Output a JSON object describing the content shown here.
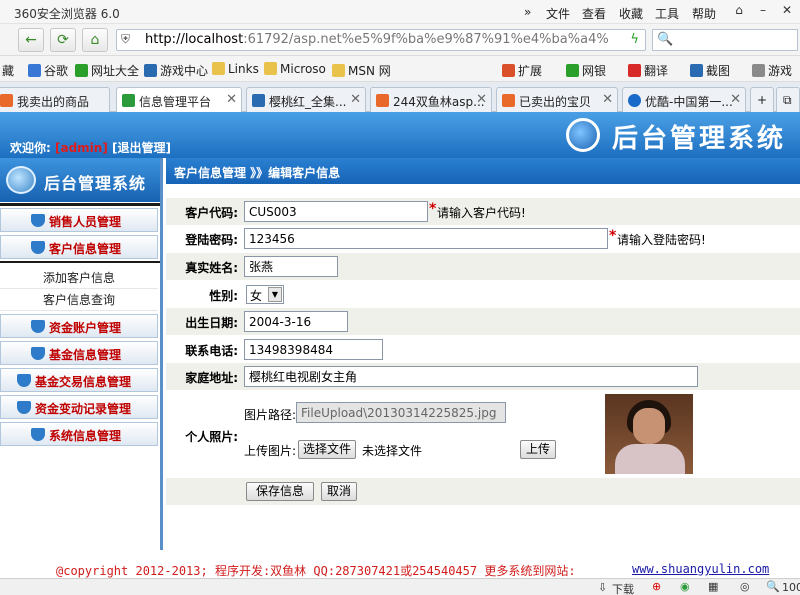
{
  "browser": {
    "title": "360安全浏览器 6.0",
    "menu": [
      "文件",
      "查看",
      "收藏",
      "工具",
      "帮助"
    ],
    "url_host": "http://localhost",
    "url_rest": ":61792/asp.net%e5%9f%ba%e9%87%91%e4%ba%a4%",
    "bookmarks": [
      "藏",
      "谷歌",
      "网址大全",
      "游戏中心",
      "Links",
      "Microso",
      "MSN 网"
    ],
    "toolbar_right": [
      "扩展",
      "网银",
      "翻译",
      "截图",
      "游戏"
    ],
    "tabs": [
      {
        "label": "我卖出的商品",
        "color": "#e8692a"
      },
      {
        "label": "信息管理平台",
        "color": "#2a9a3a"
      },
      {
        "label": "樱桃红_全集...",
        "color": "#2a6ab0"
      },
      {
        "label": "244双鱼林asp...",
        "color": "#e8692a"
      },
      {
        "label": "已卖出的宝贝",
        "color": "#e8692a"
      },
      {
        "label": "优酷-中国第一...",
        "color": "#1a6ac9"
      }
    ],
    "status": {
      "download": "下载",
      "zoom": "100"
    }
  },
  "header": {
    "welcome": "欢迎你:",
    "user": "[admin]",
    "logout": "[退出管理]",
    "system_title": "后台管理系统"
  },
  "sidebar": {
    "title": "后台管理系统",
    "items": [
      {
        "label": "销售人员管理"
      },
      {
        "label": "客户信息管理"
      },
      {
        "label": "资金账户管理"
      },
      {
        "label": "基金信息管理"
      },
      {
        "label": "基金交易信息管理"
      },
      {
        "label": "资金变动记录管理"
      },
      {
        "label": "系统信息管理"
      }
    ],
    "subitems": [
      "添加客户信息",
      "客户信息查询"
    ]
  },
  "main": {
    "breadcrumb": "客户信息管理 》》编辑客户信息",
    "fields": {
      "customer_code": {
        "label": "客户代码:",
        "value": "CUS003",
        "hint": "请输入客户代码!"
      },
      "password": {
        "label": "登陆密码:",
        "value": "123456",
        "hint": "请输入登陆密码!"
      },
      "real_name": {
        "label": "真实姓名:",
        "value": "张燕"
      },
      "gender": {
        "label": "性别:",
        "value": "女"
      },
      "birthday": {
        "label": "出生日期:",
        "value": "2004-3-16"
      },
      "phone": {
        "label": "联系电话:",
        "value": "13498398484"
      },
      "address": {
        "label": "家庭地址:",
        "value": "樱桃红电视剧女主角"
      },
      "photo": {
        "label": "个人照片:",
        "path_label": "图片路径:",
        "path_value": "FileUpload\\20130314225825.jpg",
        "upload_label": "上传图片:",
        "choose_file": "选择文件",
        "no_file": "未选择文件",
        "upload_button": "上传"
      }
    },
    "save_button": "保存信息",
    "cancel_button": "取消"
  },
  "footer": {
    "copyright": "@copyright 2012-2013; 程序开发:双鱼林  QQ:287307421或254540457  更多系统到网站:",
    "site": "www.shuangyulin.com"
  }
}
